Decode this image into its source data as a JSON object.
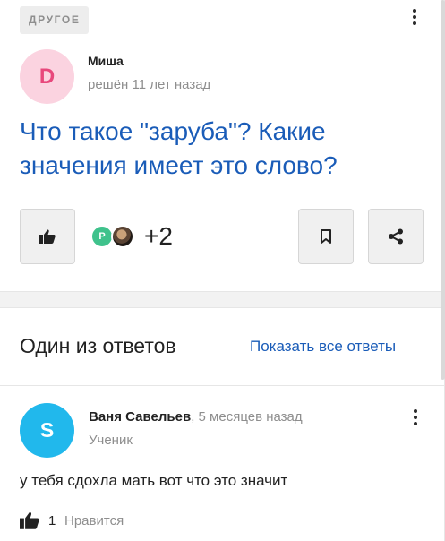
{
  "question": {
    "category": "ДРУГОЕ",
    "author": {
      "initial": "D",
      "name": "Миша",
      "avatar_bg": "#fbd3e0",
      "avatar_fg": "#e8487c"
    },
    "status": "решён 11 лет назад",
    "title": "Что такое \"заруба\"? Какие значения имеет это слово?",
    "likers": {
      "avatar1_initial": "Р",
      "count_label": "+2"
    },
    "icons": {
      "like": "thumbs-up-icon",
      "bookmark": "bookmark-icon",
      "share": "share-icon",
      "menu": "more-vertical-icon"
    }
  },
  "answers": {
    "heading": "Один из ответов",
    "show_all": "Показать все ответы",
    "item": {
      "initial": "S",
      "author": "Ваня Савельев",
      "time": ", 5 месяцев назад",
      "role": "Ученик",
      "text": "у тебя сдохла мать вот что это значит",
      "likes": "1",
      "like_label": "Нравится",
      "avatar_bg": "#21b8ec"
    }
  },
  "colors": {
    "link": "#1a5cb8",
    "muted": "#8e8e8e"
  }
}
